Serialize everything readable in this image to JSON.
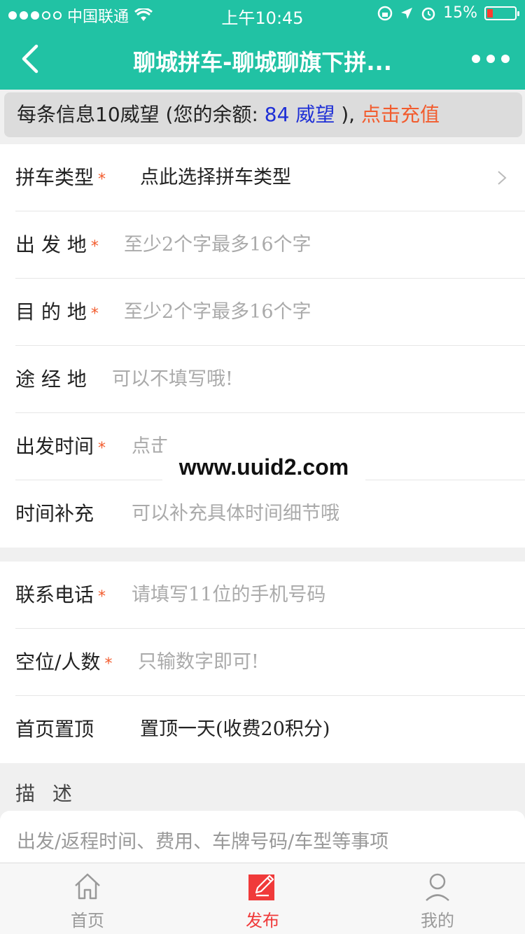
{
  "status_bar": {
    "carrier": "中国联通",
    "time": "上午10:45",
    "battery": "15%",
    "icons": [
      "signal-dots-icon",
      "wifi-icon",
      "orientation-lock-icon",
      "location-arrow-icon",
      "alarm-icon",
      "battery-icon"
    ]
  },
  "navbar": {
    "title": "聊城拼车-聊城聊旗下拼...",
    "back_icon": "back-chevron-icon",
    "more_icon": "more-dots-icon",
    "color": "#21c2a4"
  },
  "notice": {
    "prefix": "每条信息10威望 (您的余额:",
    "balance": "84 威望",
    "suffix": "),",
    "recharge": "点击充值",
    "balance_color": "#1e2fd6",
    "link_color": "#f25c2e"
  },
  "form": {
    "type": {
      "label": "拼车类型",
      "value": "点此选择拼车类型",
      "required": "*"
    },
    "origin": {
      "label": "出 发 地",
      "placeholder": "至少2个字最多16个字",
      "required": "*"
    },
    "destination": {
      "label": "目 的 地",
      "placeholder": "至少2个字最多16个字",
      "required": "*"
    },
    "via": {
      "label": "途 经 地",
      "placeholder": "可以不填写哦!"
    },
    "depart_time": {
      "label": "出发时间",
      "placeholder": "点击",
      "required": "*"
    },
    "time_note": {
      "label": "时间补充",
      "placeholder": "可以补充具体时间细节哦"
    },
    "phone": {
      "label": "联系电话",
      "placeholder": "请填写11位的手机号码",
      "required": "*"
    },
    "seats": {
      "label": "空位/人数",
      "placeholder": "只输数字即可!",
      "required": "*"
    },
    "top": {
      "label": "首页置顶",
      "value": "置顶一天(收费20积分)"
    },
    "description": {
      "label": "描 述",
      "placeholder": "出发/返程时间、费用、车牌号码/车型等事项"
    }
  },
  "watermark": "www.uuid2.com",
  "tabbar": {
    "items": [
      {
        "label": "首页",
        "icon": "home-icon"
      },
      {
        "label": "发布",
        "icon": "edit-icon",
        "active": true
      },
      {
        "label": "我的",
        "icon": "user-icon"
      }
    ],
    "active_color": "#f03a3a"
  }
}
